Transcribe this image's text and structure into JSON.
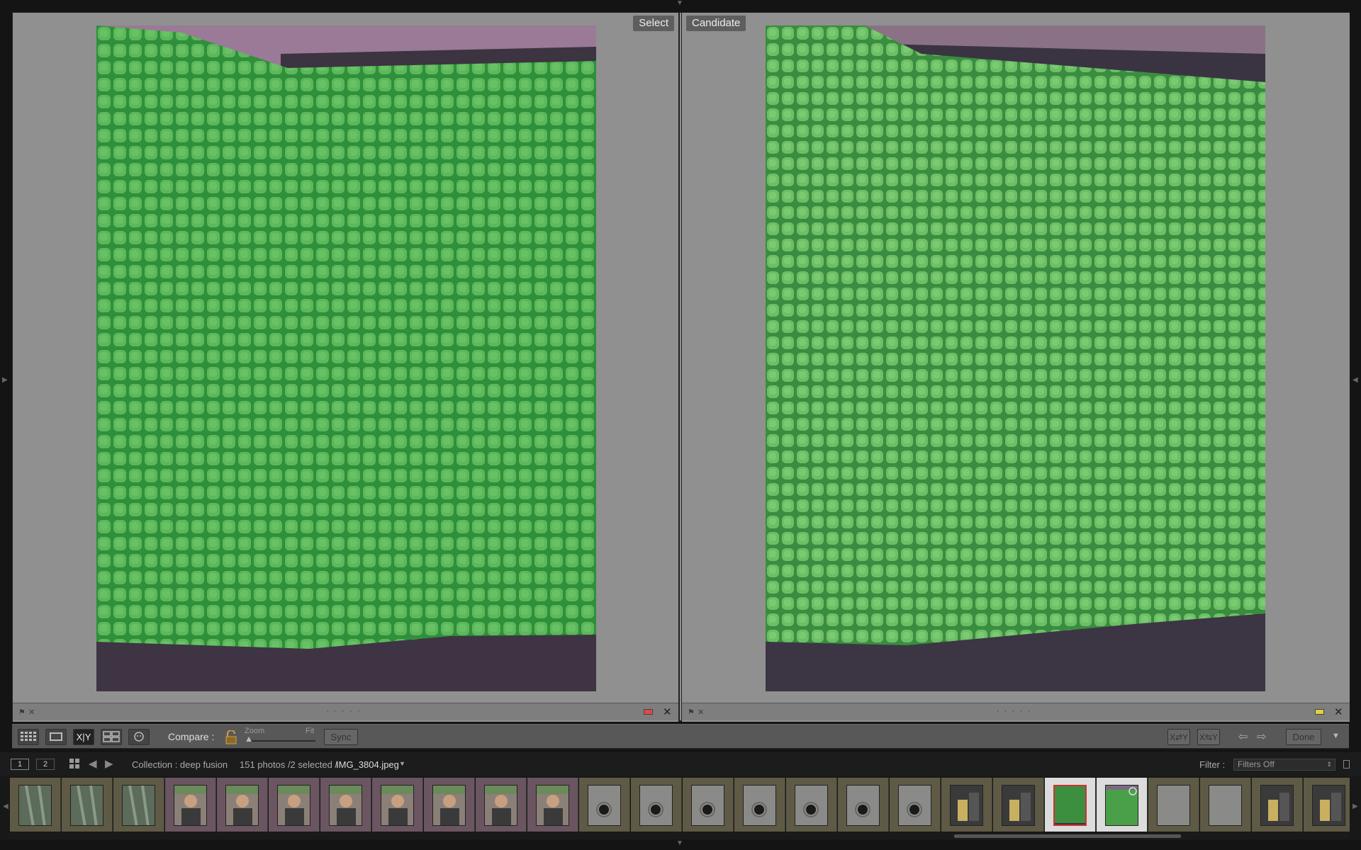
{
  "panes": {
    "select": {
      "label": "Select",
      "color_label": "#e04848"
    },
    "candidate": {
      "label": "Candidate",
      "color_label": "#e0d040"
    }
  },
  "toolbar": {
    "compare_label": "Compare :",
    "zoom_label": "Zoom",
    "fit_label": "Fit",
    "sync_label": "Sync",
    "done_label": "Done",
    "view_buttons": [
      "grid-view",
      "loupe-view",
      "compare-view",
      "survey-view",
      "people-view"
    ],
    "xy_label": "X|Y"
  },
  "secondary": {
    "monitor_1": "1",
    "monitor_2": "2",
    "collection": "Collection : deep fusion",
    "photo_count": "151 photos /2 selected /",
    "filename": "IMG_3804.jpeg",
    "filter_label": "Filter :",
    "filter_value": "Filters Off"
  },
  "filmstrip": {
    "thumbs": [
      "tree",
      "tree",
      "tree",
      "person",
      "person",
      "person",
      "person",
      "person",
      "person",
      "person",
      "person",
      "hole",
      "hole",
      "hole",
      "hole",
      "hole",
      "hole",
      "hole",
      "dark",
      "dark",
      "green-selected",
      "green",
      "gray",
      "gray",
      "dark",
      "dark"
    ]
  },
  "colors": {
    "accent_select": "#e04848",
    "accent_candidate": "#e0d040",
    "background": "#909090"
  }
}
